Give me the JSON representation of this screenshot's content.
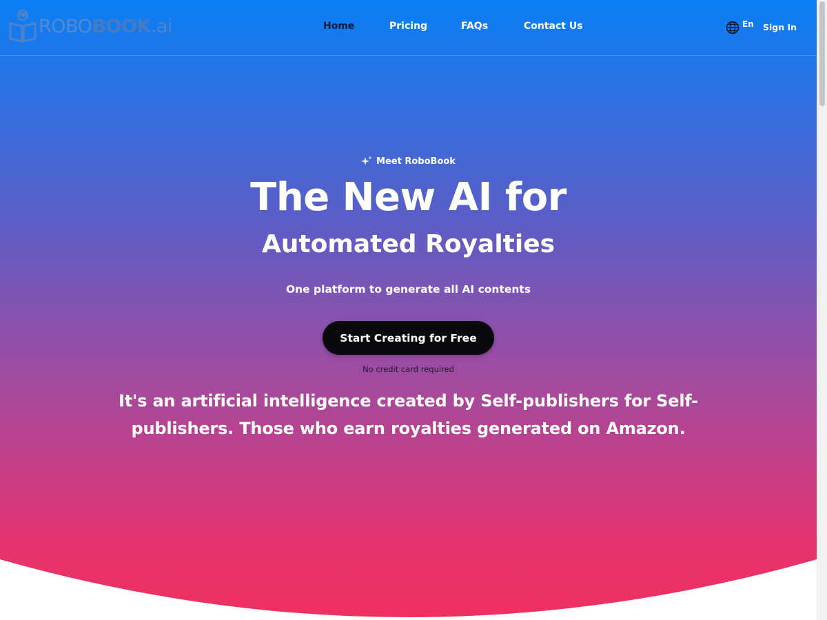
{
  "header": {
    "logo": {
      "robo": "ROBO",
      "book": "BOOK",
      "ai": ".ai"
    },
    "nav": [
      {
        "label": "Home",
        "active": true
      },
      {
        "label": "Pricing",
        "active": false
      },
      {
        "label": "FAQs",
        "active": false
      },
      {
        "label": "Contact Us",
        "active": false
      }
    ],
    "language": {
      "label": "En",
      "icon": "globe-icon"
    },
    "sign_in": "Sign In"
  },
  "hero": {
    "eyebrow": "Meet RoboBook",
    "eyebrow_icon": "sparkle-icon",
    "title_line1": "The New AI for",
    "title_line2": "Automated Royalties",
    "subtitle": "One platform to generate all AI contents",
    "cta_label": "Start Creating for Free",
    "cta_note": "No credit card required",
    "description": "It's an artificial intelligence created by Self-publishers for Self-publishers. Those who earn royalties generated on Amazon."
  },
  "colors": {
    "gradient_top": "#0a7ff5",
    "gradient_mid": "#a44a9e",
    "gradient_bottom": "#f0305f",
    "cta_bg": "#0a0a0c",
    "active_nav": "#0b1a33"
  }
}
